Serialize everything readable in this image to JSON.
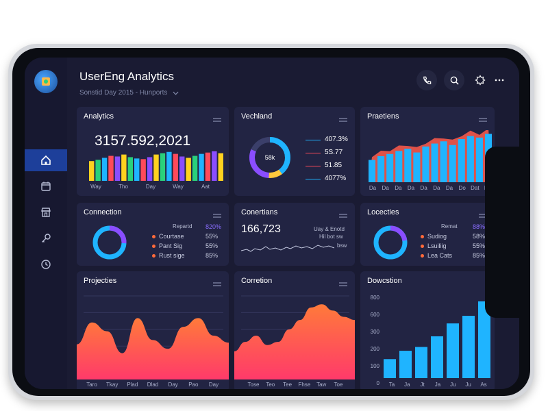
{
  "app": {
    "title": "UserEng Analytics",
    "subtitle": "Sonstid Day 2015 - Hunports"
  },
  "colors": {
    "bg": "#1a1b33",
    "card": "#222443",
    "accent_blue": "#1fb4ff",
    "accent_purple": "#8a4dff",
    "accent_red": "#ff5a4a",
    "sidebar_active": "#1d3f9a"
  },
  "sidebar": {
    "items": [
      {
        "icon": "home-icon",
        "active": true
      },
      {
        "icon": "calendar-icon",
        "active": false
      },
      {
        "icon": "store-icon",
        "active": false
      },
      {
        "icon": "key-icon",
        "active": false
      },
      {
        "icon": "clock-icon",
        "active": false
      }
    ]
  },
  "header": {
    "buttons": [
      "phone-icon",
      "search-icon",
      "settings-icon",
      "more-icon"
    ]
  },
  "cards": {
    "analytics": {
      "title": "Analytics",
      "big_number": "3157.592,2021",
      "ticks": [
        "Way",
        "Tho",
        "Day",
        "Way",
        "Aat"
      ]
    },
    "vechland": {
      "title": "Vechland",
      "center_label": "58k",
      "rows": [
        {
          "value": "407.3%",
          "color": "#1fb4ff"
        },
        {
          "value": "5S.77",
          "color": "#ff4a5a"
        },
        {
          "value": "51.85",
          "color": "#ff4a5a"
        },
        {
          "value": "4077%",
          "color": "#1fb4ff"
        }
      ]
    },
    "praetiens": {
      "title": "Praetiens",
      "ticks": [
        "Da",
        "Da",
        "Da",
        "Da",
        "Da",
        "Da",
        "Da",
        "Do",
        "Dat",
        "Do"
      ]
    },
    "connection": {
      "title": "Connection",
      "head_label": "Repartd",
      "head_value": "820%",
      "rows": [
        {
          "label": "Courtase",
          "value": "55%"
        },
        {
          "label": "Pant Sig",
          "value": "55%"
        },
        {
          "label": "Rust sige",
          "value": "85%"
        }
      ]
    },
    "conertians": {
      "title": "Conertians",
      "value": "166,723",
      "note1": "Uay & Enotd",
      "note2": "Hil bot sw",
      "note3": "bsw"
    },
    "locecties": {
      "title": "Locecties",
      "head_label": "Remat",
      "head_value": "88%",
      "rows": [
        {
          "label": "Sudiog",
          "value": "58%"
        },
        {
          "label": "Lsuiliig",
          "value": "55%"
        },
        {
          "label": "Lea Cats",
          "value": "85%"
        }
      ]
    },
    "projecties": {
      "title": "Projecties",
      "ticks": [
        "Taro",
        "Tkay",
        "Plad",
        "Dlad",
        "Day",
        "Pao",
        "Day"
      ]
    },
    "corretion": {
      "title": "Corretion",
      "ticks": [
        "Tose",
        "Teo",
        "Tee",
        "Fhse",
        "Taw",
        "Toe"
      ]
    },
    "dowcstion": {
      "title": "Dowcstion",
      "yticks": [
        "800",
        "600",
        "300",
        "200",
        "100",
        "0"
      ],
      "ticks": [
        "Ta",
        "Ja",
        "Jt",
        "Ja",
        "Ju",
        "Ju",
        "As"
      ]
    }
  },
  "chart_data": [
    {
      "type": "bar",
      "title": "Analytics",
      "categories": [
        "Way",
        "Tho",
        "Day",
        "Way",
        "Aat"
      ],
      "values": [
        30,
        32,
        35,
        38,
        37,
        40,
        36,
        34,
        33,
        36,
        40,
        42,
        44,
        41,
        37,
        35,
        38,
        41,
        43,
        45,
        42
      ]
    },
    {
      "type": "bar",
      "title": "Praetiens",
      "categories": [
        "Da",
        "Da",
        "Da",
        "Da",
        "Da",
        "Da",
        "Da",
        "Do",
        "Dat",
        "Do"
      ],
      "values": [
        30,
        35,
        38,
        42,
        45,
        40,
        48,
        52,
        55,
        50,
        58,
        62,
        60,
        65
      ]
    },
    {
      "type": "area",
      "title": "Projecties",
      "categories": [
        "Taro",
        "Tkay",
        "Plad",
        "Dlad",
        "Day",
        "Pao",
        "Day"
      ],
      "values": [
        40,
        65,
        55,
        30,
        70,
        45,
        35,
        60,
        70,
        50,
        42
      ]
    },
    {
      "type": "area",
      "title": "Corretion",
      "categories": [
        "Tose",
        "Teo",
        "Tee",
        "Fhse",
        "Taw",
        "Toe"
      ],
      "values": [
        45,
        60,
        70,
        55,
        60,
        80,
        95,
        115,
        120,
        110,
        100,
        95
      ]
    },
    {
      "type": "bar",
      "title": "Dowcstion",
      "categories": [
        "Ta",
        "Ja",
        "Jt",
        "Ja",
        "Ju",
        "Ju",
        "As"
      ],
      "values": [
        250,
        360,
        410,
        550,
        720,
        820,
        1010
      ],
      "ylim": [
        0,
        1100
      ]
    }
  ]
}
